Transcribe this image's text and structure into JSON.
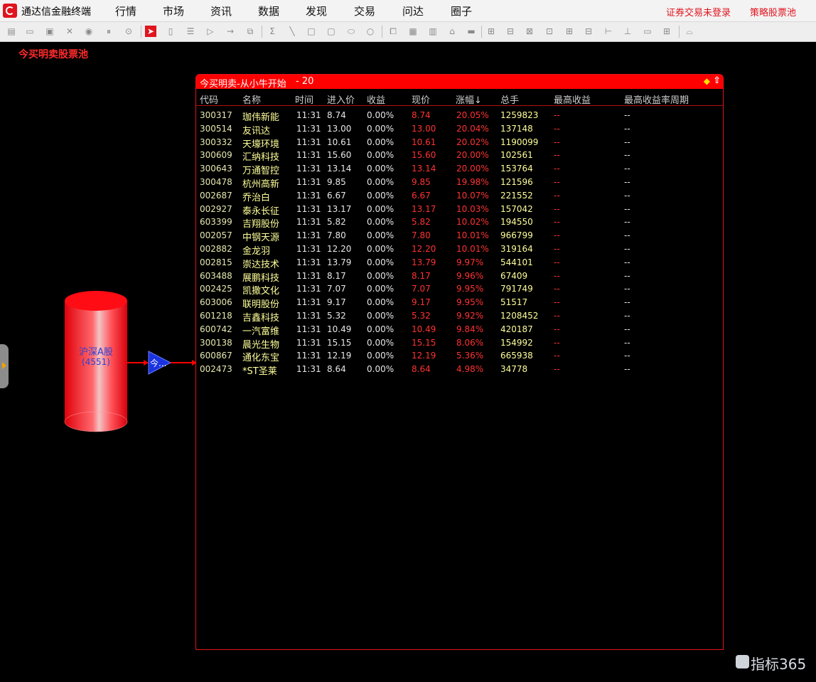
{
  "app": {
    "title": "通达信金融终端"
  },
  "menu": [
    "行情",
    "市场",
    "资讯",
    "数据",
    "发现",
    "交易",
    "问达",
    "圈子"
  ],
  "status": {
    "login": "证券交易未登录",
    "pool": "策略股票池"
  },
  "toolbar_icons": [
    "new-doc-icon",
    "open-folder-icon",
    "save-icon",
    "delete-icon",
    "play-icon",
    "pause-icon",
    "stop-icon",
    "pointer-icon",
    "rounded-rect-icon",
    "list-icon",
    "triangle-icon",
    "arrow-icon",
    "component-icon",
    "formula-icon",
    "line-icon",
    "rect-icon",
    "round-rect-icon",
    "ellipse-icon",
    "circle-icon",
    "copy-icon",
    "paste-icon",
    "trash-icon",
    "format-icon",
    "hline-icon",
    "align-left-icon",
    "align-center-icon",
    "align-right-icon",
    "align-top-icon",
    "align-middle-icon",
    "align-bottom-icon",
    "same-width-icon",
    "same-height-icon",
    "same-size-icon",
    "grid-icon",
    "tree-icon"
  ],
  "pool_title": "今买明卖股票池",
  "diagram": {
    "source_label": "沪深A股",
    "source_count": "(4551)",
    "node_label": "今..."
  },
  "window": {
    "title": "今买明卖-从小牛开始",
    "count": "- 20",
    "pin_icon": "diamond-pin-icon",
    "collapse_icon": "up-arrow-icon"
  },
  "table": {
    "headers": [
      "代码",
      "名称",
      "时间",
      "进入价",
      "收益",
      "现价",
      "涨幅↓",
      "总手",
      "最高收益",
      "最高收益率周期"
    ],
    "rows": [
      [
        "300317",
        "珈伟新能",
        "11:31",
        "8.74",
        "0.00%",
        "8.74",
        "20.05%",
        "1259823",
        "--",
        "--"
      ],
      [
        "300514",
        "友讯达",
        "11:31",
        "13.00",
        "0.00%",
        "13.00",
        "20.04%",
        "137148",
        "--",
        "--"
      ],
      [
        "300332",
        "天壕环境",
        "11:31",
        "10.61",
        "0.00%",
        "10.61",
        "20.02%",
        "1190099",
        "--",
        "--"
      ],
      [
        "300609",
        "汇纳科技",
        "11:31",
        "15.60",
        "0.00%",
        "15.60",
        "20.00%",
        "102561",
        "--",
        "--"
      ],
      [
        "300643",
        "万通智控",
        "11:31",
        "13.14",
        "0.00%",
        "13.14",
        "20.00%",
        "153764",
        "--",
        "--"
      ],
      [
        "300478",
        "杭州高新",
        "11:31",
        "9.85",
        "0.00%",
        "9.85",
        "19.98%",
        "121596",
        "--",
        "--"
      ],
      [
        "002687",
        "乔治白",
        "11:31",
        "6.67",
        "0.00%",
        "6.67",
        "10.07%",
        "221552",
        "--",
        "--"
      ],
      [
        "002927",
        "泰永长征",
        "11:31",
        "13.17",
        "0.00%",
        "13.17",
        "10.03%",
        "157042",
        "--",
        "--"
      ],
      [
        "603399",
        "吉翔股份",
        "11:31",
        "5.82",
        "0.00%",
        "5.82",
        "10.02%",
        "194550",
        "--",
        "--"
      ],
      [
        "002057",
        "中钢天源",
        "11:31",
        "7.80",
        "0.00%",
        "7.80",
        "10.01%",
        "966799",
        "--",
        "--"
      ],
      [
        "002882",
        "金龙羽",
        "11:31",
        "12.20",
        "0.00%",
        "12.20",
        "10.01%",
        "319164",
        "--",
        "--"
      ],
      [
        "002815",
        "崇达技术",
        "11:31",
        "13.79",
        "0.00%",
        "13.79",
        "9.97%",
        "544101",
        "--",
        "--"
      ],
      [
        "603488",
        "展鹏科技",
        "11:31",
        "8.17",
        "0.00%",
        "8.17",
        "9.96%",
        "67409",
        "--",
        "--"
      ],
      [
        "002425",
        "凯撒文化",
        "11:31",
        "7.07",
        "0.00%",
        "7.07",
        "9.95%",
        "791749",
        "--",
        "--"
      ],
      [
        "603006",
        "联明股份",
        "11:31",
        "9.17",
        "0.00%",
        "9.17",
        "9.95%",
        "51517",
        "--",
        "--"
      ],
      [
        "601218",
        "吉鑫科技",
        "11:31",
        "5.32",
        "0.00%",
        "5.32",
        "9.92%",
        "1208452",
        "--",
        "--"
      ],
      [
        "600742",
        "一汽富维",
        "11:31",
        "10.49",
        "0.00%",
        "10.49",
        "9.84%",
        "420187",
        "--",
        "--"
      ],
      [
        "300138",
        "晨光生物",
        "11:31",
        "15.15",
        "0.00%",
        "15.15",
        "8.06%",
        "154992",
        "--",
        "--"
      ],
      [
        "600867",
        "通化东宝",
        "11:31",
        "12.19",
        "0.00%",
        "12.19",
        "5.36%",
        "665938",
        "--",
        "--"
      ],
      [
        "002473",
        "*ST圣莱",
        "11:31",
        "8.64",
        "0.00%",
        "8.64",
        "4.98%",
        "34778",
        "--",
        "--"
      ]
    ]
  },
  "watermark": {
    "text": "指标365"
  },
  "colors": {
    "accent": "#e0141e",
    "name_text": "#ffff9a",
    "up_text": "#ff3232",
    "node_blue": "#1a33e0"
  }
}
